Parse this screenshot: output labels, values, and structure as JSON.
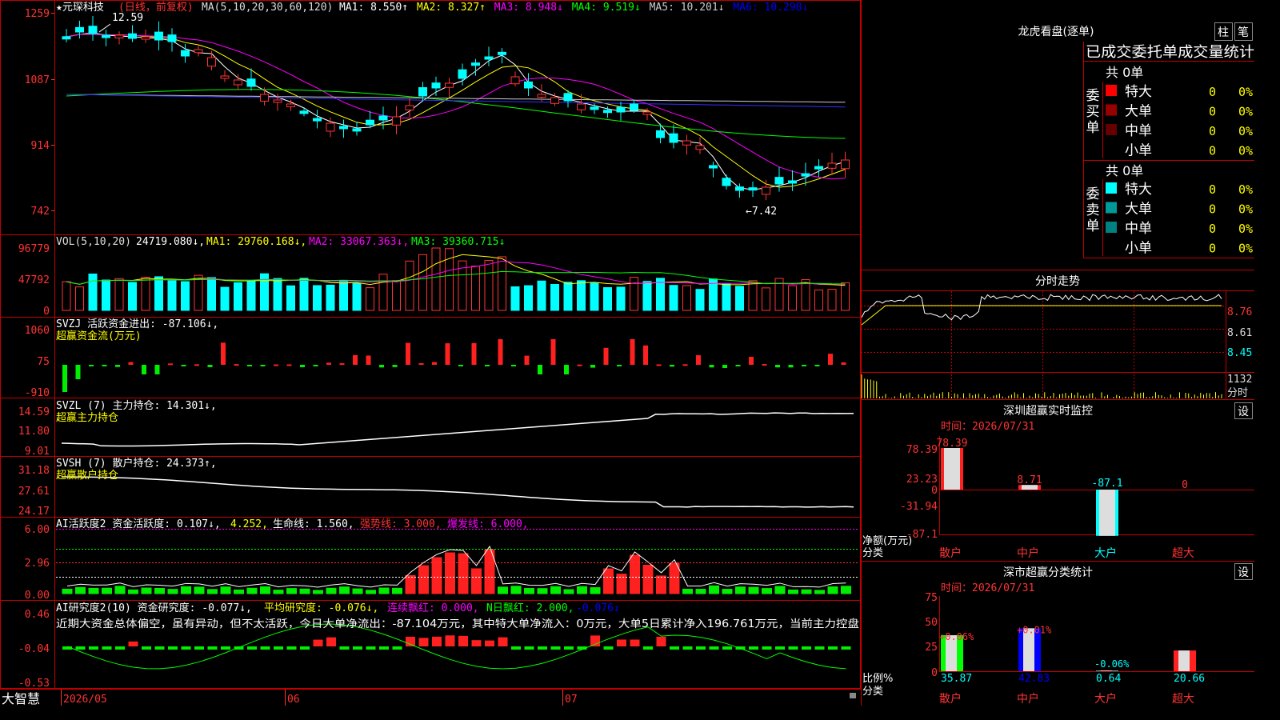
{
  "stock": {
    "title": "★元琛科技",
    "period": "(日线，前复权)",
    "high_mark": "12.59",
    "low_mark": "←7.42"
  },
  "ma_line": {
    "label": "MA(5,10,20,30,60,120)",
    "items": [
      {
        "label": "MA1: 8.550↑",
        "color": "#ffffff"
      },
      {
        "label": "MA2: 8.327↑",
        "color": "#ffff00"
      },
      {
        "label": "MA3: 8.948↓",
        "color": "#ff00ff"
      },
      {
        "label": "MA4: 9.519↓",
        "color": "#00ff00"
      },
      {
        "label": "MA5: 10.201↓",
        "color": "#cccccc"
      },
      {
        "label": "MA6: 10.298↓",
        "color": "#0000ff"
      }
    ]
  },
  "axes": {
    "price": [
      "1259",
      "1087",
      "914",
      "742"
    ],
    "vol": [
      "96779",
      "47792",
      "0"
    ],
    "svzj": [
      "1060",
      "75",
      "-910"
    ],
    "svzl": [
      "14.59",
      "11.80",
      "9.01"
    ],
    "svsh": [
      "31.18",
      "27.61",
      "24.17"
    ],
    "ai1": [
      "6.00",
      "2.96",
      "0.00"
    ],
    "ai2": [
      "0.46",
      "-0.04",
      "-0.53"
    ]
  },
  "vol_panel": {
    "label": "VOL(5,10,20)",
    "value": "24719.080↓,",
    "ma1": "MA1: 29760.168↓,",
    "ma2": "MA2: 33067.363↓,",
    "ma3": "MA3: 39360.715↓"
  },
  "svzj_panel": {
    "label": "SVZJ  活跃资金进出: -87.106↓,",
    "sub": "超赢资金流(万元)"
  },
  "svzl_panel": {
    "label": "SVZL (7) 主力持仓: 14.301↓,",
    "sub": "超赢主力持仓"
  },
  "svsh_panel": {
    "label": "SVSH (7) 散户持仓: 24.373↑,",
    "sub": "超赢散户持仓"
  },
  "ai1_panel": {
    "label": "AI活跃度2 资金活跃度: 0.107↓,",
    "v2": "4.252,",
    "life": "生命线: 1.560,",
    "strong": "强势线: 3.000,",
    "burst": "爆发线: 6.000,"
  },
  "ai2_panel": {
    "label": "AI研究度2(10) 资金研究度: -0.077↓,",
    "avg": "平均研究度: -0.076↓,",
    "lianxu": "连续飘红: 0.000,",
    "nday": "N日飘红: 2.000,",
    "last": "-0.076↓",
    "comment": "近期大资金总体偏空，虽有异动，但不太活跃，今日大单净流出：-87.104万元，其中特大单净流入：0万元，大单5日累计净入196.761万元，当前主力控盘"
  },
  "date_axis": {
    "brand": "大智慧",
    "labels": [
      "2026/05",
      "06",
      "07"
    ]
  },
  "lhb": {
    "title": "龙虎看盘(逐单)",
    "btn_zhu": "柱",
    "btn_bi": "笔",
    "tabs": "已成交委托单成交量统计",
    "buy_side": "委买单",
    "sell_side": "委卖单",
    "buy_total": "共 0单",
    "sell_total": "共 0单",
    "buy_rows": [
      {
        "name": "特大",
        "n": "0",
        "pct": "0%",
        "color": "#ff0000"
      },
      {
        "name": "大单",
        "n": "0",
        "pct": "0%",
        "color": "#990000"
      },
      {
        "name": "中单",
        "n": "0",
        "pct": "0%",
        "color": "#660000"
      },
      {
        "name": "小单",
        "n": "0",
        "pct": "0%",
        "color": ""
      }
    ],
    "sell_rows": [
      {
        "name": "特大",
        "n": "0",
        "pct": "0%",
        "color": "#00ffff"
      },
      {
        "name": "大单",
        "n": "0",
        "pct": "0%",
        "color": "#009999"
      },
      {
        "name": "中单",
        "n": "0",
        "pct": "0%",
        "color": "#008080"
      },
      {
        "name": "小单",
        "n": "0",
        "pct": "0%",
        "color": ""
      }
    ]
  },
  "intraday": {
    "title": "分时走势",
    "prices": [
      "8.76",
      "8.61",
      "8.45"
    ],
    "vol_label": "1132",
    "vol_unit": "分时"
  },
  "sz_monitor": {
    "title": "深圳超赢实时监控",
    "btn": "设",
    "time": "时间：2026/07/31",
    "axis": [
      "78.39",
      "23.23",
      "0",
      "-31.94",
      "-87.1"
    ],
    "unit": "净额(万元)",
    "cat_label": "分类",
    "categories": [
      "散户",
      "中户",
      "大户",
      "超大"
    ],
    "values": [
      78.39,
      8.71,
      -87.1,
      0
    ],
    "value_labels": [
      "78.39",
      "8.71",
      "-87.1",
      "0"
    ]
  },
  "sh_stats": {
    "title": "深市超赢分类统计",
    "btn": "设",
    "time": "时间：2026/07/31",
    "axis": [
      "75",
      "50",
      "25",
      "0"
    ],
    "unit": "比例%",
    "cat_label": "分类",
    "categories": [
      "散户",
      "中户",
      "大户",
      "超大"
    ],
    "values": [
      35.87,
      42.83,
      0.64,
      20.66
    ],
    "changes": [
      "+0.06%",
      "+0.01%",
      "-0.06%",
      ""
    ]
  }
}
